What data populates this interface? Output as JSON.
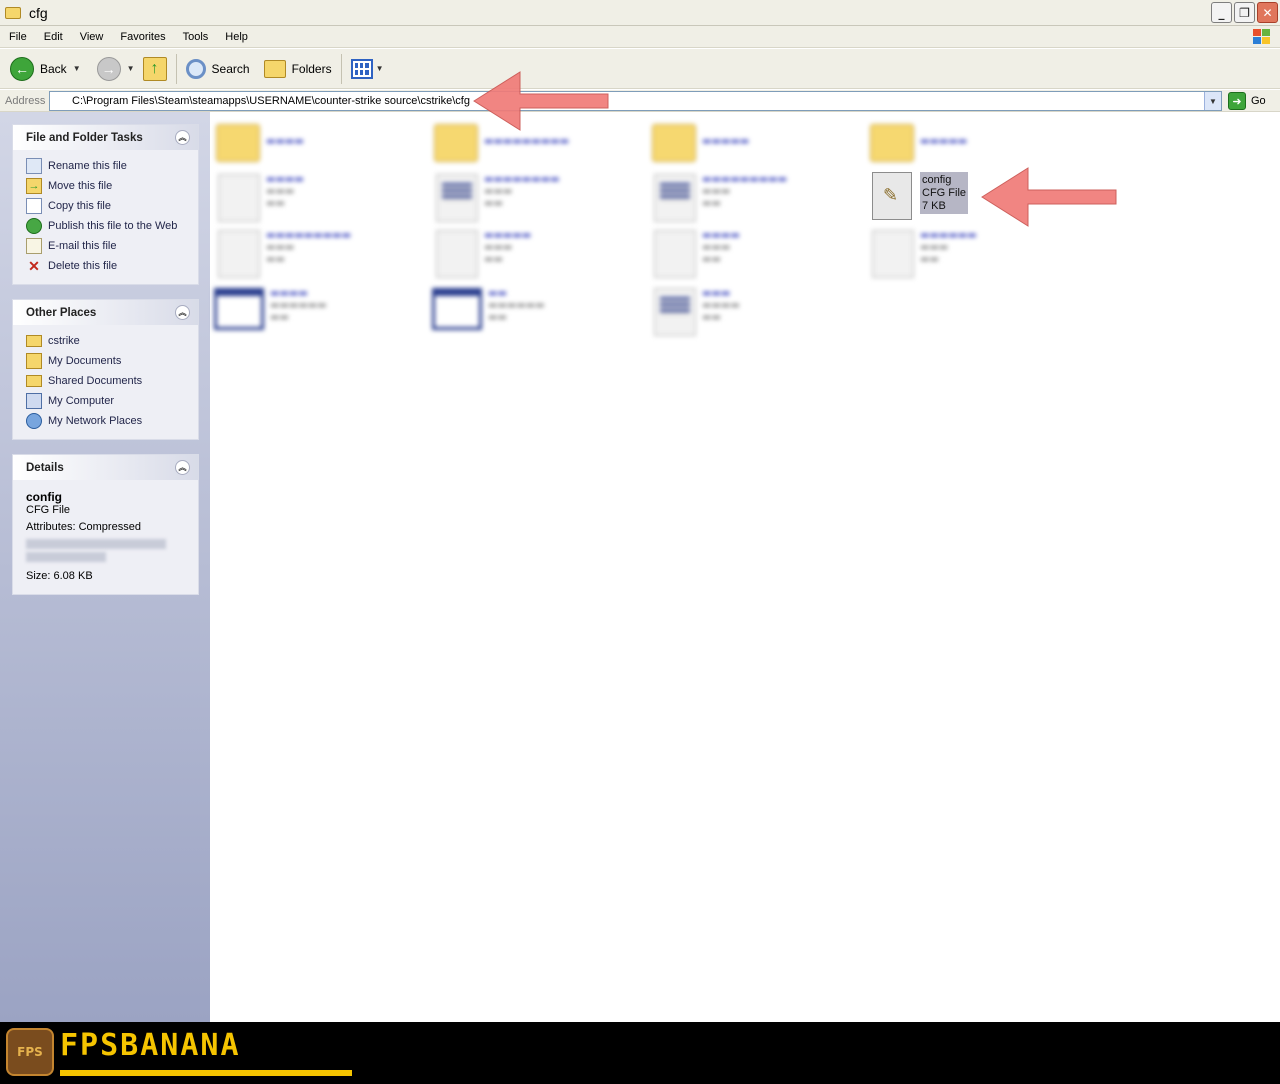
{
  "window": {
    "title": "cfg"
  },
  "menu": [
    "File",
    "Edit",
    "View",
    "Favorites",
    "Tools",
    "Help"
  ],
  "toolbar": {
    "back": "Back",
    "search": "Search",
    "folders": "Folders"
  },
  "address": {
    "label": "Address",
    "path": "C:\\Program Files\\Steam\\steamapps\\USERNAME\\counter-strike source\\cstrike\\cfg",
    "go": "Go"
  },
  "tasks": {
    "title": "File and Folder Tasks",
    "items": [
      "Rename this file",
      "Move this file",
      "Copy this file",
      "Publish this file to the Web",
      "E-mail this file",
      "Delete this file"
    ]
  },
  "places": {
    "title": "Other Places",
    "items": [
      "cstrike",
      "My Documents",
      "Shared Documents",
      "My Computer",
      "My Network Places"
    ]
  },
  "details": {
    "title": "Details",
    "name": "config",
    "type": "CFG File",
    "attributes": "Attributes: Compressed",
    "size": "Size: 6.08 KB"
  },
  "selected_file": {
    "name": "config",
    "type": "CFG File",
    "size": "7 KB"
  },
  "footer": {
    "logo": "FPSBANANA"
  },
  "colors": {
    "arrow": "#f07b78",
    "selection": "#b6b6c5"
  }
}
